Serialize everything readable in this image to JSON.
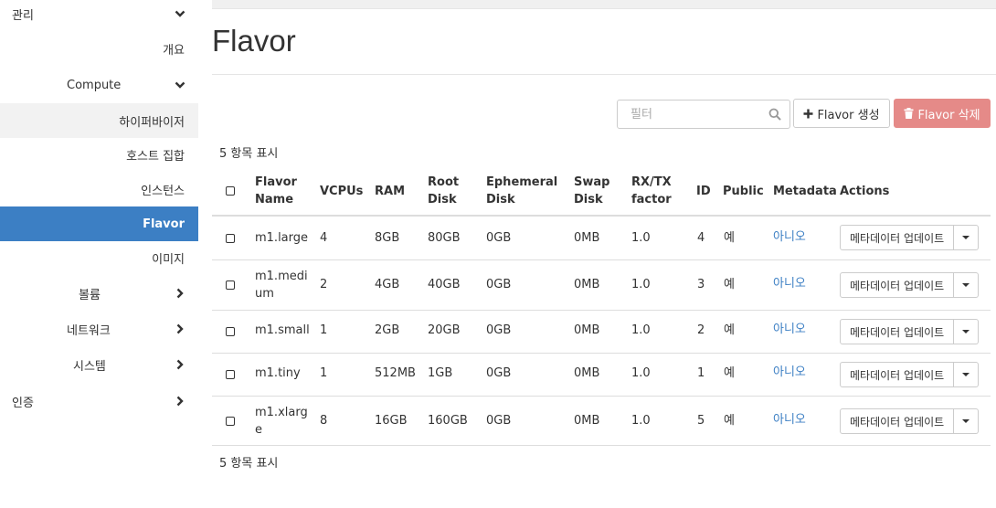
{
  "sidebar": {
    "items": [
      {
        "label": "관리",
        "chevron": "down"
      },
      {
        "label": "개요",
        "chevron": "none"
      },
      {
        "label": "Compute",
        "chevron": "down"
      },
      {
        "label": "하이퍼바이저",
        "chevron": "none"
      },
      {
        "label": "호스트 집합",
        "chevron": "none"
      },
      {
        "label": "인스턴스",
        "chevron": "none"
      },
      {
        "label": "Flavor",
        "chevron": "none",
        "active": true
      },
      {
        "label": "이미지",
        "chevron": "none"
      },
      {
        "label": "볼륨",
        "chevron": "right"
      },
      {
        "label": "네트워크",
        "chevron": "right"
      },
      {
        "label": "시스템",
        "chevron": "right"
      },
      {
        "label": "인증",
        "chevron": "right"
      }
    ]
  },
  "page": {
    "title": "Flavor"
  },
  "toolbar": {
    "filter_placeholder": "필터",
    "create_label": "Flavor 생성",
    "delete_label": "Flavor 삭제"
  },
  "count_top": "5 항목 표시",
  "count_bottom": "5 항목 표시",
  "table": {
    "headers": {
      "name": [
        "Flavor",
        "Name"
      ],
      "vcpus": [
        "VCPUs"
      ],
      "ram": [
        "RAM"
      ],
      "root": [
        "Root",
        "Disk"
      ],
      "ephemeral": [
        "Ephemeral",
        "Disk"
      ],
      "swap": [
        "Swap",
        "Disk"
      ],
      "rxtx": [
        "RX/TX",
        "factor"
      ],
      "id": [
        "ID"
      ],
      "public": [
        "Public"
      ],
      "metadata": [
        "Metadata"
      ],
      "actions": [
        "Actions"
      ]
    },
    "rows": [
      {
        "name": [
          "m1.large"
        ],
        "vcpus": "4",
        "ram": "8GB",
        "root": "80GB",
        "ephemeral": "0GB",
        "swap": "0MB",
        "rxtx": "1.0",
        "id": "4",
        "public": "예",
        "metadata": "아니오",
        "action": "메타데이터 업데이트"
      },
      {
        "name": [
          "m1.medi",
          "um"
        ],
        "vcpus": "2",
        "ram": "4GB",
        "root": "40GB",
        "ephemeral": "0GB",
        "swap": "0MB",
        "rxtx": "1.0",
        "id": "3",
        "public": "예",
        "metadata": "아니오",
        "action": "메타데이터 업데이트"
      },
      {
        "name": [
          "m1.small"
        ],
        "vcpus": "1",
        "ram": "2GB",
        "root": "20GB",
        "ephemeral": "0GB",
        "swap": "0MB",
        "rxtx": "1.0",
        "id": "2",
        "public": "예",
        "metadata": "아니오",
        "action": "메타데이터 업데이트"
      },
      {
        "name": [
          "m1.tiny"
        ],
        "vcpus": "1",
        "ram": "512MB",
        "root": "1GB",
        "ephemeral": "0GB",
        "swap": "0MB",
        "rxtx": "1.0",
        "id": "1",
        "public": "예",
        "metadata": "아니오",
        "action": "메타데이터 업데이트"
      },
      {
        "name": [
          "m1.xlarg",
          "e"
        ],
        "vcpus": "8",
        "ram": "16GB",
        "root": "160GB",
        "ephemeral": "0GB",
        "swap": "0MB",
        "rxtx": "1.0",
        "id": "5",
        "public": "예",
        "metadata": "아니오",
        "action": "메타데이터 업데이트"
      }
    ]
  },
  "colors": {
    "active_nav": "#3c7fc4",
    "link": "#3c7fc4",
    "danger_button": "#e58a88"
  },
  "icons": {
    "search": "search-icon",
    "create": "plus-icon",
    "delete": "trash-icon",
    "chevron_down": "chevron-down-icon",
    "chevron_right": "chevron-right-icon",
    "caret": "caret-down-icon"
  }
}
